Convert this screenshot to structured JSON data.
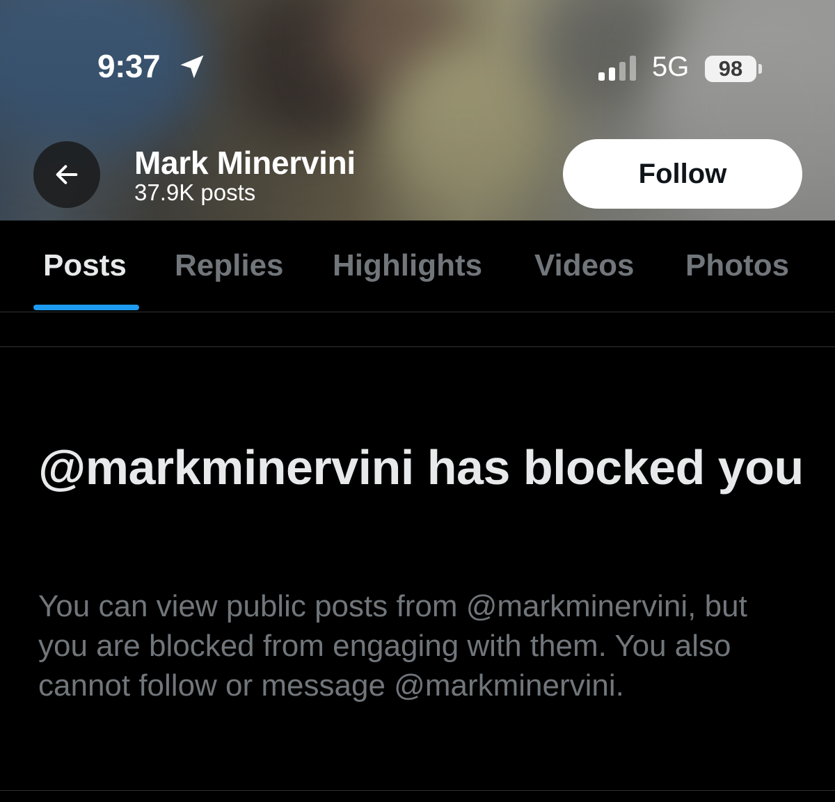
{
  "status_bar": {
    "time": "9:37",
    "location_icon": "location-arrow-icon",
    "signal_icon": "cellular-signal-icon",
    "network": "5G",
    "battery": "98"
  },
  "header": {
    "back_icon": "arrow-left-icon",
    "name": "Mark Minervini",
    "post_count": "37.9K posts",
    "follow_label": "Follow"
  },
  "tabs": [
    {
      "label": "Posts",
      "active": true
    },
    {
      "label": "Replies",
      "active": false
    },
    {
      "label": "Highlights",
      "active": false
    },
    {
      "label": "Videos",
      "active": false
    },
    {
      "label": "Photos",
      "active": false
    }
  ],
  "blocked": {
    "title": "@markminervini has blocked you",
    "description": "You can view public posts from @markminervini, but you are blocked from engaging with them. You also cannot follow or message @markminervini."
  },
  "colors": {
    "background": "#000000",
    "accent": "#1d9bf0",
    "primary_text": "#e7e9ea",
    "secondary_text": "#71767b",
    "follow_button_bg": "#ffffff"
  }
}
